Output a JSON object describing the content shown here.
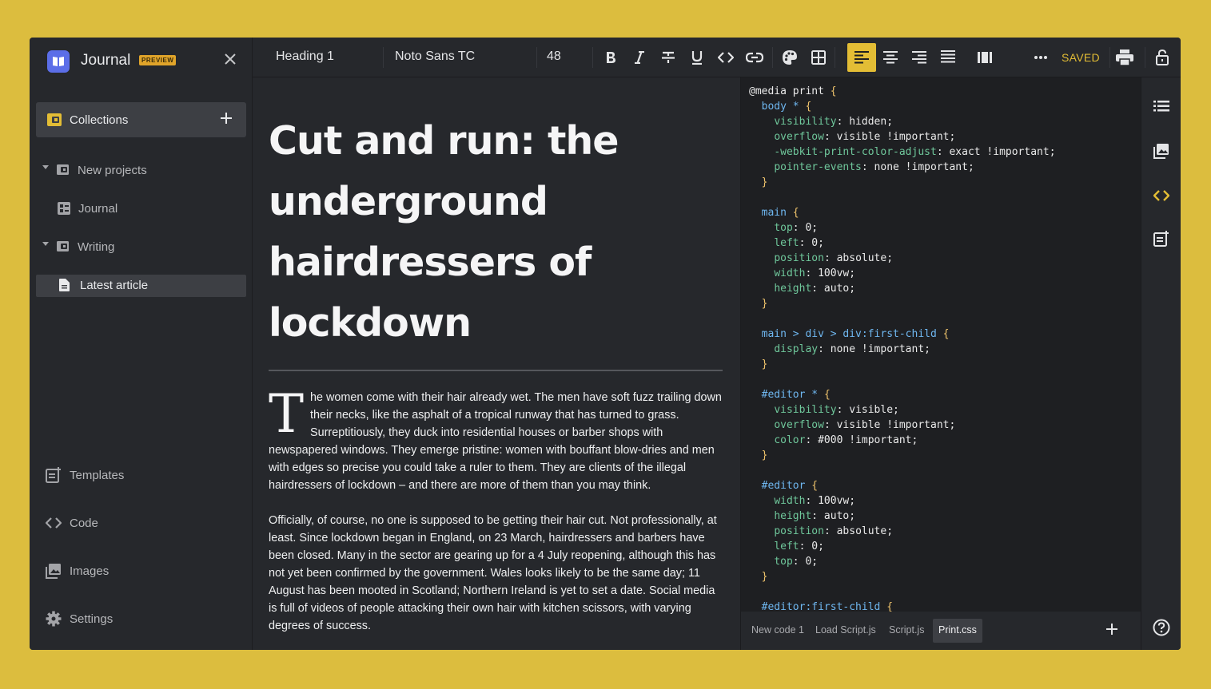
{
  "app": {
    "title": "Journal",
    "badge": "PREVIEW"
  },
  "sidebar": {
    "collections_label": "Collections",
    "tree": [
      {
        "label": "New projects",
        "type": "folder",
        "expanded": true
      },
      {
        "label": "Journal",
        "type": "grid"
      },
      {
        "label": "Writing",
        "type": "folder",
        "expanded": true
      },
      {
        "label": "Latest article",
        "type": "document",
        "active": true
      }
    ],
    "bottom": [
      {
        "label": "Templates",
        "icon": "templates-icon"
      },
      {
        "label": "Code",
        "icon": "code-icon"
      },
      {
        "label": "Images",
        "icon": "images-icon"
      },
      {
        "label": "Settings",
        "icon": "gear-icon"
      }
    ]
  },
  "toolbar": {
    "style": "Heading 1",
    "font": "Noto Sans TC",
    "size": "48",
    "saved_label": "SAVED",
    "accent": "#e3bd35"
  },
  "article": {
    "title": "Cut and run: the underground hairdressers of lockdown",
    "dropcap": "T",
    "p1": "he women come with their hair already wet. The men have soft fuzz trailing down their necks, like the asphalt of a tropical runway that has turned to grass. Surreptitiously, they duck into residential houses or barber shops with newspapered windows. They emerge pristine: women with bouffant blow-dries and men with edges so precise you could take a ruler to them. They are clients of the illegal hairdressers of lockdown – and there are more of them than you may think.",
    "p2": "Officially, of course, no one is supposed to be getting their hair cut. Not professionally, at least. Since lockdown began in England, on 23 March, hairdressers and barbers have been closed. Many in the sector are gearing up for a 4 July reopening, although this has not yet been confirmed by the government. Wales looks likely to be the same day; 11 August has been mooted in Scotland; Northern Ireland is yet to set a date. Social media is full of videos of people attacking their own hair with kitchen scissors, with varying degrees of success."
  },
  "code": {
    "tabs": [
      "New code 1",
      "Load Script.js",
      "Script.js",
      "Print.css"
    ],
    "active_tab": "Print.css",
    "lines": [
      "@media print {",
      "  body * {",
      "    visibility: hidden;",
      "    overflow: visible !important;",
      "    -webkit-print-color-adjust: exact !important;",
      "    pointer-events: none !important;",
      "  }",
      "",
      "  main {",
      "    top: 0;",
      "    left: 0;",
      "    position: absolute;",
      "    width: 100vw;",
      "    height: auto;",
      "  }",
      "",
      "  main > div > div:first-child {",
      "    display: none !important;",
      "  }",
      "",
      "  #editor * {",
      "    visibility: visible;",
      "    overflow: visible !important;",
      "    color: #000 !important;",
      "  }",
      "",
      "  #editor {",
      "    width: 100vw;",
      "    height: auto;",
      "    position: absolute;",
      "    left: 0;",
      "    top: 0;",
      "  }",
      "",
      "  #editor:first-child {"
    ]
  }
}
